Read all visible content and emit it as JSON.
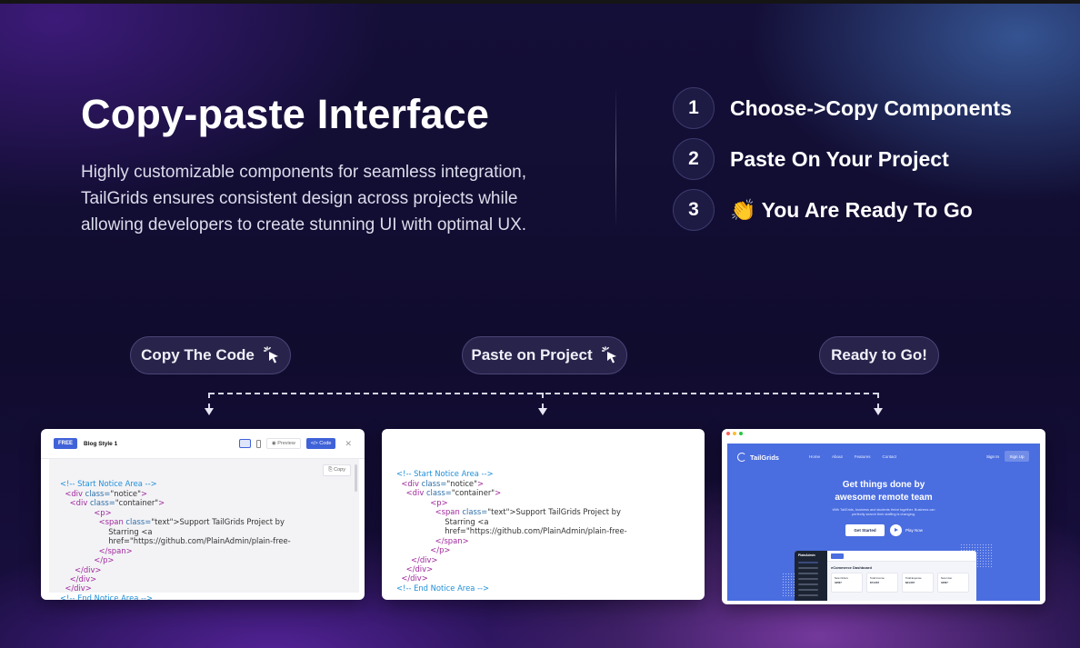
{
  "hero": {
    "title": "Copy-paste Interface",
    "description_lines": [
      "Highly customizable components for seamless integration,",
      "TailGrids ensures consistent design across projects while",
      "allowing developers to create stunning UI with optimal UX."
    ]
  },
  "steps": [
    {
      "number": "1",
      "label": "Choose->Copy Components"
    },
    {
      "number": "2",
      "label": "Paste On Your Project"
    },
    {
      "number": "3",
      "emoji": "👏",
      "label": "You Are Ready To Go"
    }
  ],
  "pills": [
    {
      "label": "Copy The Code",
      "icon": "click-cursor-icon"
    },
    {
      "label": "Paste on Project",
      "icon": "click-cursor-icon"
    },
    {
      "label": "Ready to Go!"
    }
  ],
  "code_card": {
    "badge": "FREE",
    "title": "Blog Style 1",
    "preview_label": "Preview",
    "code_label": "</> Code",
    "copy_label": "Copy",
    "close_icon": "close-icon",
    "view_icons": [
      "monitor-icon",
      "phone-icon"
    ]
  },
  "code_lines": {
    "l1": "<!-- Start Notice Area -->",
    "l2_tag": "<div ",
    "l2_attr": "class=",
    "l2_val": "\"notice\"",
    "l2_end": ">",
    "l3_tag": "<div ",
    "l3_attr": "class=",
    "l3_val": "\"container\"",
    "l3_end": ">",
    "l4": "<p>",
    "l5_tag": "<span ",
    "l5_attr": "class=",
    "l5_val": "\"text\"",
    "l5_rest": ">Support TailGrids Project by",
    "l6": "Starring <a",
    "l7": "href=\"https://github.com/PlainAdmin/plain-free-",
    "l8": "</span>",
    "l9": "</p>",
    "l10": "</div>",
    "l11": "</div>",
    "l12": "</div>",
    "l13": "<!-- End Notice Area -->"
  },
  "site_preview": {
    "logo": "TailGrids",
    "nav": [
      "Home",
      "About",
      "Features",
      "Contact"
    ],
    "sign_in": "Sign In",
    "sign_up": "Sign Up",
    "headline_1": "Get things done by",
    "headline_2": "awesome remote team",
    "subtext": "With TailGrids, business and students thrive together. Business can perfectly search their staffing is changing.",
    "cta": "Get Started",
    "play_label": "Play Now",
    "dashboard_brand": "PlainAdmin",
    "dashboard_title": "eCommerce Dashboard",
    "stats": [
      "New Orders",
      "Total Income",
      "Total Expense",
      "New User"
    ],
    "stat_values": [
      "34567",
      "$74,567",
      "$24,567",
      "34567"
    ],
    "window_dot_colors": [
      "#ff5f57",
      "#febc2e",
      "#28c840"
    ]
  },
  "colors": {
    "accent": "#4062d8",
    "site_blue": "#4a6de0",
    "code_comment": "#1f8fd8",
    "code_tag": "#a0289c"
  }
}
